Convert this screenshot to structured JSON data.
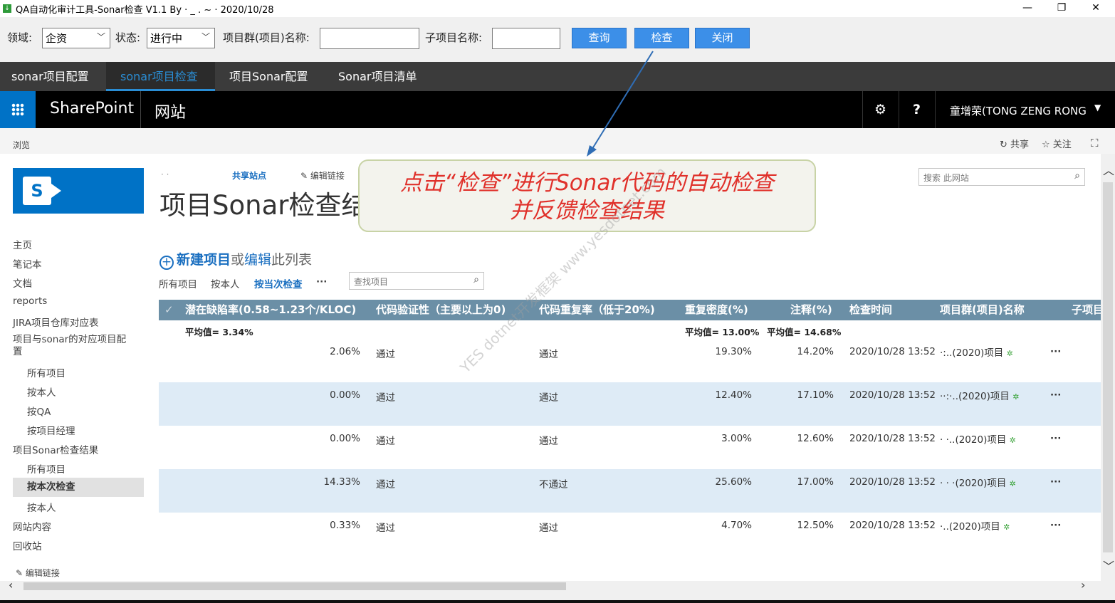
{
  "window": {
    "title": "QA自动化审计工具-Sonar检查 V1.1  By ·    _ .  ~  · 2020/10/28",
    "minimize": "—",
    "restore": "❐",
    "close": "✕"
  },
  "toolbar": {
    "domain_label": "领域:",
    "domain_value": "企资",
    "status_label": "状态:",
    "status_value": "进行中",
    "project_group_label": "项目群(项目)名称:",
    "project_group_value": "",
    "sub_project_label": "子项目名称:",
    "sub_project_value": "",
    "query_button": "查询",
    "check_button": "检查",
    "close_button": "关闭"
  },
  "tabs": [
    {
      "label": "sonar项目配置",
      "active": false
    },
    {
      "label": "sonar项目检查",
      "active": true
    },
    {
      "label": "项目Sonar配置",
      "active": false
    },
    {
      "label": "Sonar项目清单",
      "active": false
    }
  ],
  "sharepoint": {
    "brand": "SharePoint",
    "site": "网站",
    "settings_icon": "⚙",
    "help_icon": "?",
    "user": "童增荣(TONG ZENG RONG",
    "caret": "▼"
  },
  "ribbon": {
    "browse": "浏览",
    "share": "共享",
    "follow": "关注"
  },
  "page": {
    "breadcrumb_blank": "·     ·",
    "breadcrumb_shared": "共享站点",
    "edit_links": "编辑链接",
    "title": "项目Sonar检查结",
    "search_placeholder": "搜索 此网站"
  },
  "callout": {
    "line1": "点击“检查”进行Sonar代码的自动检查",
    "line2": "并反馈检查结果"
  },
  "nav": {
    "items": [
      "主页",
      "笔记本",
      "文档",
      "reports",
      "JIRA项目仓库对应表",
      "项目与sonar的对应项目配置"
    ],
    "sub1": [
      "所有项目",
      "按本人",
      "按QA",
      "按项目经理"
    ],
    "section2": "项目Sonar检查结果",
    "sub2": [
      "所有项目",
      "按本次检查",
      "按本人"
    ],
    "tail": [
      "网站内容",
      "回收站"
    ],
    "edit_links": "编辑链接"
  },
  "list": {
    "new_item": "新建项目",
    "or": "或",
    "edit": "编辑",
    "this_list": "此列表",
    "views": [
      "所有项目",
      "按本人",
      "按当次检查"
    ],
    "more": "···",
    "find_placeholder": "查找项目"
  },
  "columns": [
    "潜在缺陷率(0.58~1.23个/KLOC)",
    "代码验证性（主要以上为0)",
    "代码重复率（低于20%)",
    "重复密度(%)",
    "注释(%)",
    "检查时间",
    "项目群(项目)名称",
    "子项目"
  ],
  "averages": {
    "defect": "平均值= 3.34%",
    "dup": "平均值= 13.00%",
    "comment": "平均值= 14.68%"
  },
  "rows": [
    {
      "defect": "2.06%",
      "verify": "通过",
      "repeat": "通过",
      "dup": "19.30%",
      "comment": "14.20%",
      "time": "2020/10/28 13:52",
      "project": "·:..(2020)项目"
    },
    {
      "defect": "0.00%",
      "verify": "通过",
      "repeat": "通过",
      "dup": "12.40%",
      "comment": "17.10%",
      "time": "2020/10/28 13:52",
      "project": "··:·..(2020)项目"
    },
    {
      "defect": "0.00%",
      "verify": "通过",
      "repeat": "通过",
      "dup": "3.00%",
      "comment": "12.60%",
      "time": "2020/10/28 13:52",
      "project": "·  ·..(2020)项目"
    },
    {
      "defect": "14.33%",
      "verify": "通过",
      "repeat": "不通过",
      "dup": "25.60%",
      "comment": "17.00%",
      "time": "2020/10/28 13:52",
      "project": "· · ·(2020)项目"
    },
    {
      "defect": "0.33%",
      "verify": "通过",
      "repeat": "通过",
      "dup": "4.70%",
      "comment": "12.50%",
      "time": "2020/10/28 13:52",
      "project": "·..(2020)项目"
    }
  ],
  "row_more": "···",
  "new_star": "✲",
  "watermark": "YES dotnet开发框架 www.yesdotnet.com",
  "colors": {
    "tab_bar": "#3b3b3b",
    "accent": "#2a8dd4",
    "button": "#3c8fe8",
    "sharepoint_blue": "#0072c6",
    "grid_header": "#6b8fa6",
    "row_alt": "#deebf6",
    "callout_text": "#e0312b"
  }
}
